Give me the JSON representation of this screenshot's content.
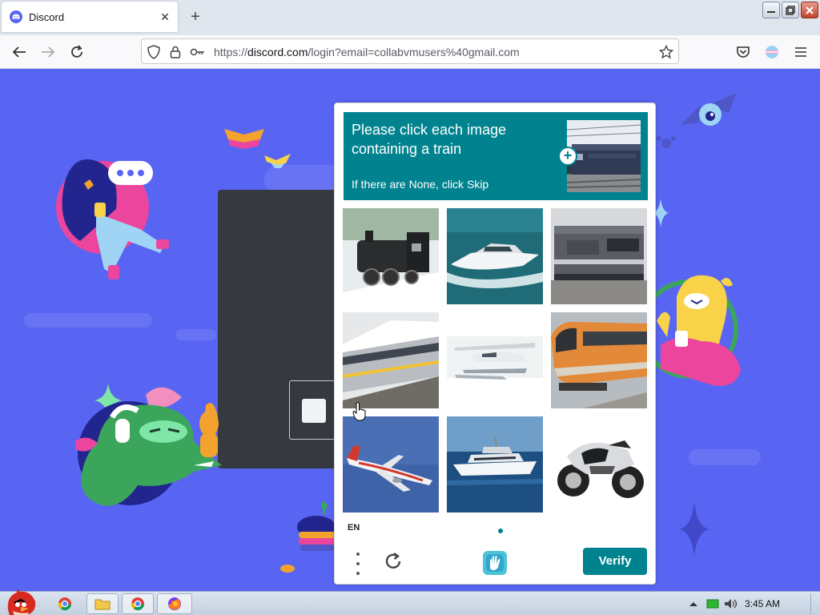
{
  "browser": {
    "tab_title": "Discord",
    "url_prefix": "https://",
    "url_host": "discord.com",
    "url_path": "/login?email=collabvmusers%40gmail.com"
  },
  "captcha": {
    "prompt": "Please click each image containing a train",
    "subprompt": "If there are None, click Skip",
    "language": "EN",
    "verify_label": "Verify",
    "accent_color": "#00838f",
    "tiles": [
      {
        "subject": "steam-locomotive"
      },
      {
        "subject": "speedboat"
      },
      {
        "subject": "diesel-locomotive"
      },
      {
        "subject": "passenger-train"
      },
      {
        "subject": "seaplane"
      },
      {
        "subject": "orange-train"
      },
      {
        "subject": "airliner"
      },
      {
        "subject": "yacht"
      },
      {
        "subject": "motorcycle"
      }
    ]
  },
  "taskbar": {
    "clock": "3:45 AM"
  },
  "colors": {
    "discord_background": "#5865f2"
  }
}
